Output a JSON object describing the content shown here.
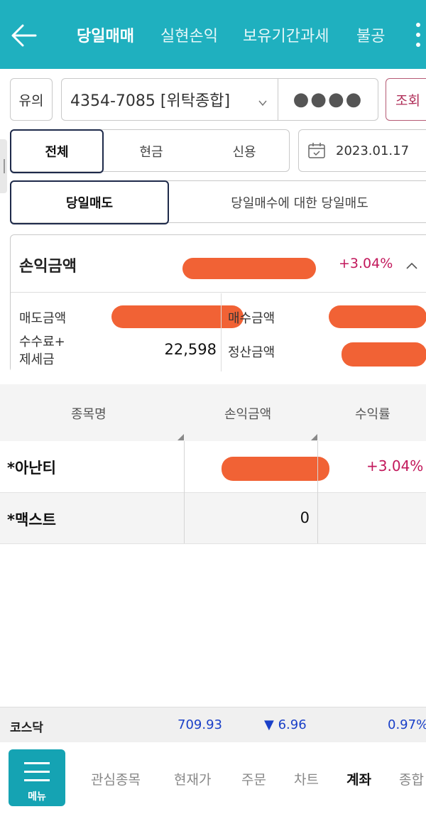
{
  "header": {
    "tabs": [
      {
        "label": "당일매매",
        "active": true
      },
      {
        "label": "실현손익",
        "active": false
      },
      {
        "label": "보유기간과세",
        "active": false
      },
      {
        "label": "불공",
        "active": false
      }
    ],
    "bg_color": "#1fb0bf"
  },
  "account": {
    "warning_label": "유의",
    "account_value": "4354-7085 [위탁종합]",
    "password_mask": "●●●●",
    "query_label": "조회"
  },
  "filter": {
    "type_tabs": [
      {
        "label": "전체",
        "active": true
      },
      {
        "label": "현금",
        "active": false
      },
      {
        "label": "신용",
        "active": false
      }
    ],
    "date": "2023.01.17",
    "mode_tabs": [
      {
        "label": "당일매도",
        "active": true
      },
      {
        "label": "당일매수에 대한 당일매도",
        "active": false
      }
    ]
  },
  "summary": {
    "title": "손익금액",
    "profit_rate": "+3.04%",
    "sell_amount_label": "매도금액",
    "buy_amount_label": "매수금액",
    "fee_tax_label_1": "수수료+",
    "fee_tax_label_2": "제세금",
    "fee_tax_value": "22,598",
    "settlement_label": "정산금액"
  },
  "table": {
    "headers": [
      "종목명",
      "손익금액",
      "수익률"
    ],
    "rows": [
      {
        "name": "*아난티",
        "pnl": "",
        "rate": "+3.04%"
      },
      {
        "name": "*맥스트",
        "pnl": "0",
        "rate": ""
      }
    ]
  },
  "ticker": {
    "name": "코스닥",
    "value": "709.93",
    "change": "▼ 6.96",
    "percent": "0.97%"
  },
  "bottom_nav": {
    "menu_label": "메뉴",
    "items": [
      {
        "label": "관심종목",
        "active": false
      },
      {
        "label": "현재가",
        "active": false
      },
      {
        "label": "주문",
        "active": false
      },
      {
        "label": "차트",
        "active": false
      },
      {
        "label": "계좌",
        "active": true
      },
      {
        "label": "종합",
        "active": false
      }
    ]
  },
  "colors": {
    "accent": "#1fb0bf",
    "profit": "#c2185b",
    "down": "#1a40c8",
    "redaction": "#f05a2a"
  }
}
